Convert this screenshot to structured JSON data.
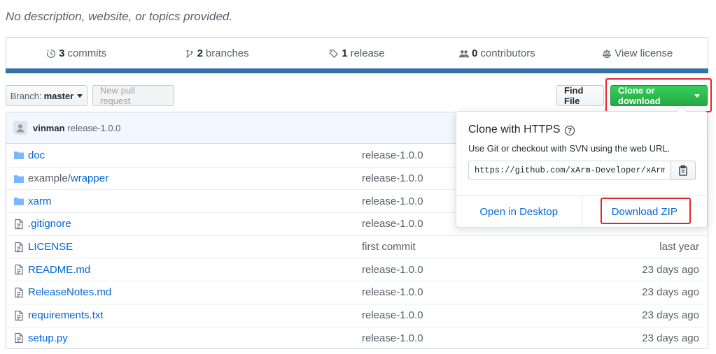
{
  "repo": {
    "description": "No description, website, or topics provided."
  },
  "summary": {
    "commits_count": "3",
    "commits_label": "commits",
    "branches_count": "2",
    "branches_label": "branches",
    "releases_count": "1",
    "releases_label": "release",
    "contributors_count": "0",
    "contributors_label": "contributors",
    "license_label": "View license",
    "language_color": "#3572A5"
  },
  "toolbar": {
    "branch_prefix": "Branch:",
    "branch_name": "master",
    "new_pull_request": "New pull request",
    "find_file": "Find File",
    "clone_or_download": "Clone or download"
  },
  "commit": {
    "author": "vinman",
    "message": "release-1.0.0"
  },
  "files": [
    {
      "type": "folder",
      "name": "doc",
      "message": "release-1.0.0",
      "age": ""
    },
    {
      "type": "folder",
      "name_prefix": "example/",
      "name": "wrapper",
      "message": "release-1.0.0",
      "age": ""
    },
    {
      "type": "folder",
      "name": "xarm",
      "message": "release-1.0.0",
      "age": ""
    },
    {
      "type": "file",
      "name": ".gitignore",
      "message": "release-1.0.0",
      "age": ""
    },
    {
      "type": "file",
      "name": "LICENSE",
      "message": "first commit",
      "age": "last year"
    },
    {
      "type": "file",
      "name": "README.md",
      "message": "release-1.0.0",
      "age": "23 days ago"
    },
    {
      "type": "file",
      "name": "ReleaseNotes.md",
      "message": "release-1.0.0",
      "age": "23 days ago"
    },
    {
      "type": "file",
      "name": "requirements.txt",
      "message": "release-1.0.0",
      "age": "23 days ago"
    },
    {
      "type": "file",
      "name": "setup.py",
      "message": "release-1.0.0",
      "age": "23 days ago"
    }
  ],
  "clone": {
    "title": "Clone with HTTPS",
    "help": "?",
    "subtitle": "Use Git or checkout with SVN using the web URL.",
    "url": "https://github.com/xArm-Developer/xArm-P",
    "open_desktop": "Open in Desktop",
    "download_zip": "Download ZIP"
  },
  "colors": {
    "highlight": "#e8232b",
    "primary_button": "#28a745",
    "link": "#0366d6"
  }
}
